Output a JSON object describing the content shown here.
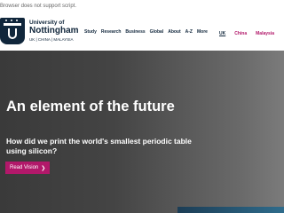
{
  "noscript_message": "Browser does not support script.",
  "logo": {
    "line1": "University of",
    "line2": "Nottingham",
    "line3": "UK | CHINA | MALAYSIA"
  },
  "nav": {
    "items": [
      "Study",
      "Research",
      "Business",
      "Global",
      "About",
      "A-Z",
      "More"
    ]
  },
  "campus": {
    "items": [
      "UK",
      "China",
      "Malaysia"
    ],
    "selected": "UK"
  },
  "hero": {
    "title": "An element of the future",
    "subtitle": "How did we print the world's smallest periodic table using silicon?",
    "cta_label": "Read Vision",
    "cta_icon": "chevron-right-icon"
  },
  "colors": {
    "brand_navy": "#10263b",
    "accent_pink": "#b2186a"
  }
}
